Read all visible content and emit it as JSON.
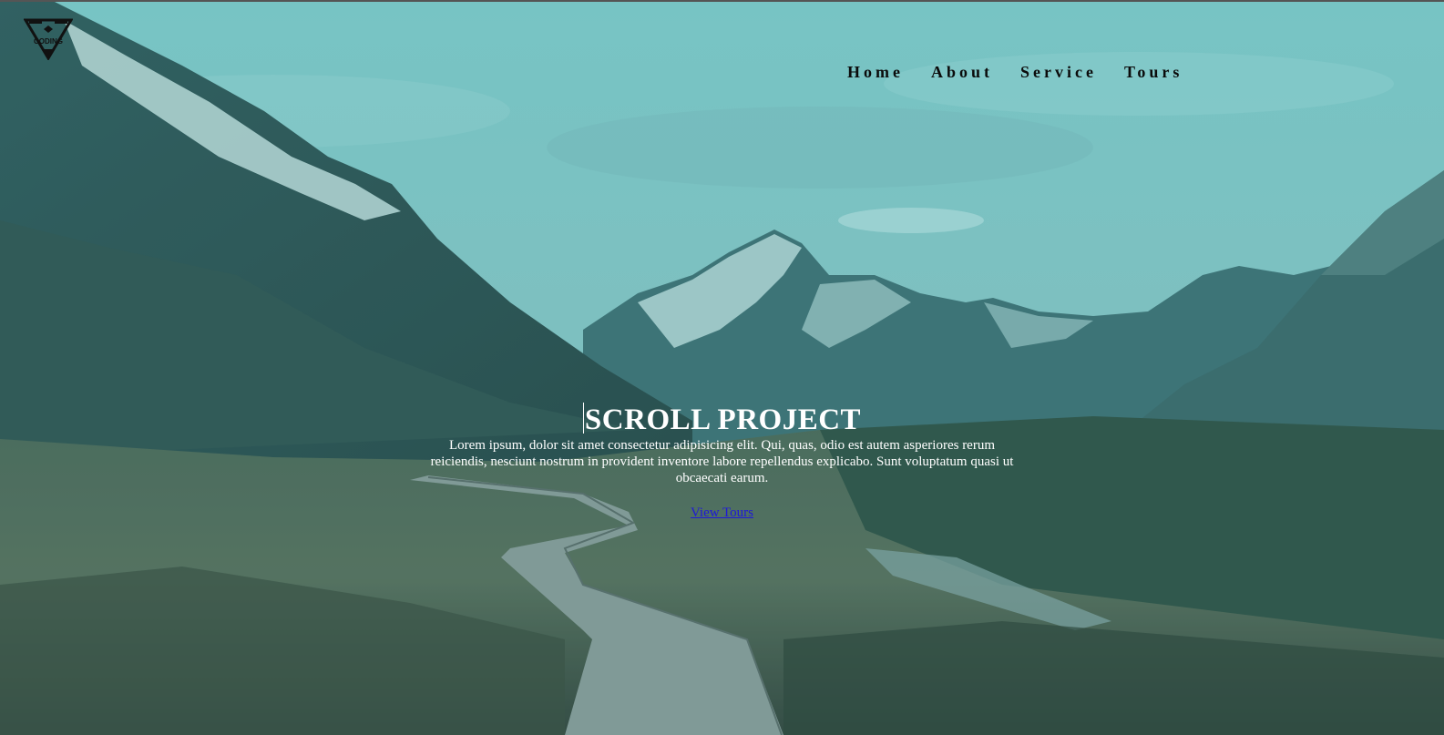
{
  "nav": {
    "items": [
      {
        "label": "Home"
      },
      {
        "label": "About"
      },
      {
        "label": "Service"
      },
      {
        "label": "Tours"
      }
    ]
  },
  "logo": {
    "text": "CODING"
  },
  "banner": {
    "title": "SCROLL PROJECT",
    "description": "Lorem ipsum, dolor sit amet consectetur adipisicing elit. Qui, quas, odio est autem asperiores rerum reiciendis, nesciunt nostrum in provident inventore labore repellendus explicabo. Sunt voluptatum quasi ut obcaecati earum.",
    "link_label": "View Tours"
  },
  "colors": {
    "sky": "#7fc4c4",
    "overlay": "#3b9a9a",
    "nav_text": "#0b0b0b",
    "link": "#1e18d8"
  }
}
